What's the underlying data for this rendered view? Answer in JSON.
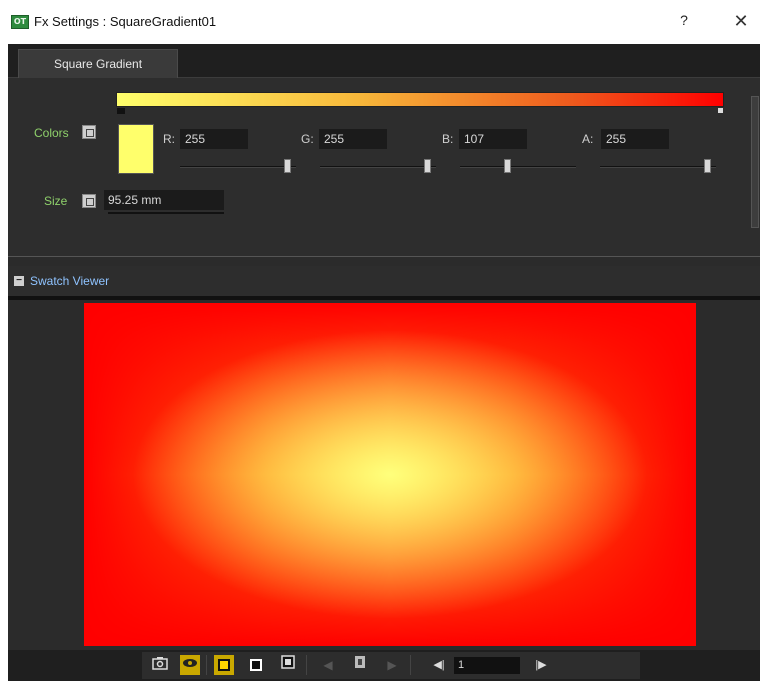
{
  "window": {
    "app_icon_text": "OT",
    "title": "Fx Settings : SquareGradient01",
    "help_glyph": "?",
    "close_glyph": "✕"
  },
  "tabs": [
    {
      "label": "Square Gradient",
      "active": true
    }
  ],
  "gradient": {
    "colors_label": "Colors",
    "start_color": "#ffff6b",
    "end_color": "#ff0000"
  },
  "color_channels": {
    "swatch_color": "#ffff6b",
    "r": {
      "label": "R:",
      "value": "255",
      "level": 1.0
    },
    "g": {
      "label": "G:",
      "value": "255",
      "level": 1.0
    },
    "b": {
      "label": "B:",
      "value": "107",
      "level": 0.42
    },
    "a": {
      "label": "A:",
      "value": "255",
      "level": 1.0
    }
  },
  "size": {
    "label": "Size",
    "value": "95.25 mm"
  },
  "swatch_viewer": {
    "collapse_glyph": "−",
    "title": "Swatch Viewer"
  },
  "toolbar": {
    "icons": [
      "camera-icon",
      "preview-eye-icon",
      "white-bg-icon",
      "black-bg-icon",
      "checker-bg-icon",
      "prev-arrow-icon",
      "keyframe-icon",
      "next-arrow-icon",
      "prev-frame-icon",
      "next-frame-icon"
    ],
    "prev_frame_glyph": "◀|",
    "next_frame_glyph": "|▶",
    "frame_value": "1",
    "accent": "#c9a800"
  },
  "colors": {
    "label_green": "#8fd16b",
    "viewer_title_blue": "#8fc3ff",
    "panel_bg": "#2b2b2b"
  }
}
